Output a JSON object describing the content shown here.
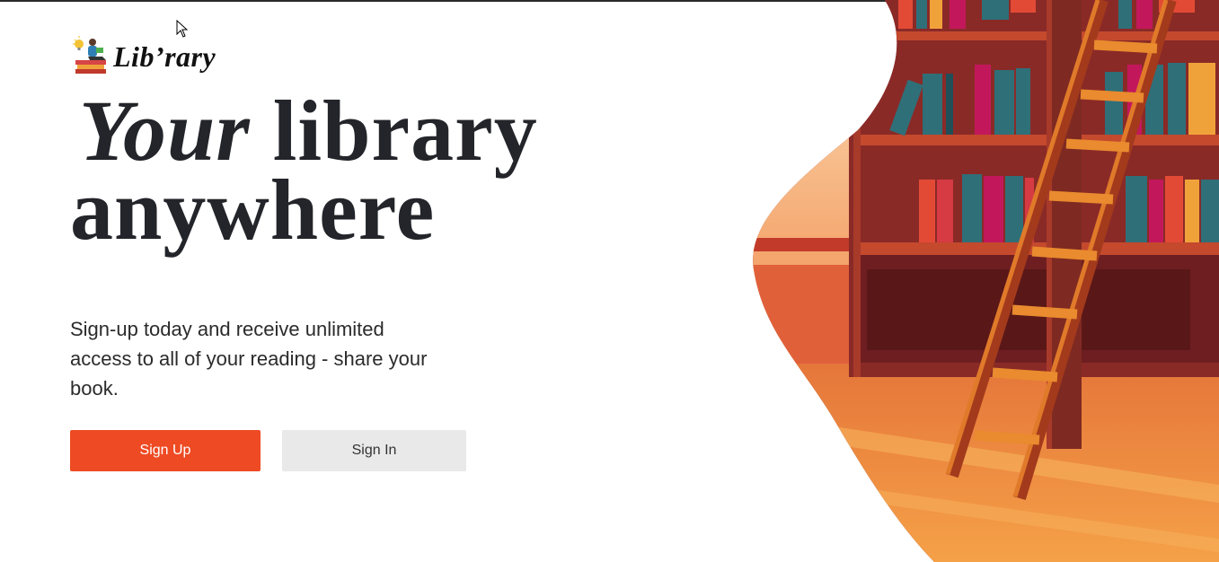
{
  "brand": {
    "name": "Lib’rary",
    "logo_icon": "reader-on-books-icon"
  },
  "hero": {
    "headline_italic": "Your",
    "headline_rest": "library",
    "headline_line2": "anywhere",
    "subtitle": "Sign-up today and receive unlimited access to all of your reading - share your book."
  },
  "actions": {
    "signup_label": "Sign Up",
    "signin_label": "Sign In"
  },
  "illustration": {
    "subject": "library-bookshelves-with-ladder"
  },
  "colors": {
    "accent": "#ee4a24",
    "secondary_button": "#e9e9e9",
    "headline_text": "#23252a"
  }
}
